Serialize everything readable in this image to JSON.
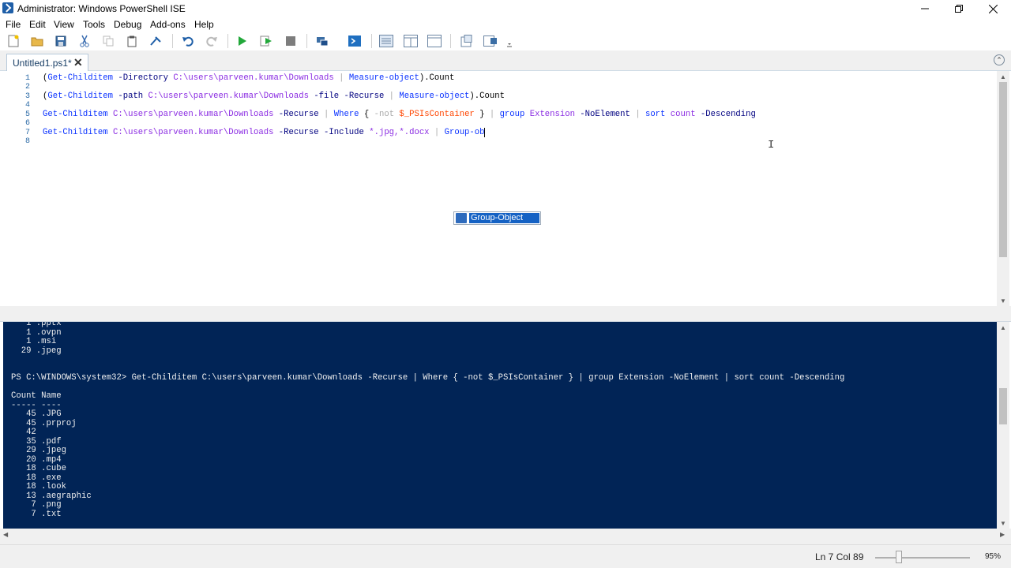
{
  "window": {
    "title": "Administrator: Windows PowerShell ISE",
    "controls": [
      "minimize",
      "restore",
      "close"
    ]
  },
  "menu": {
    "items": [
      "File",
      "Edit",
      "View",
      "Tools",
      "Debug",
      "Add-ons",
      "Help"
    ]
  },
  "toolbar": {
    "icons": [
      "new-file-icon",
      "open-folder-icon",
      "save-icon",
      "cut-icon",
      "copy-icon",
      "paste-icon",
      "clear-icon",
      "undo-icon",
      "redo-icon",
      "run-icon",
      "run-selection-icon",
      "stop-icon",
      "remote-powershell-icon",
      "powershell-console-icon",
      "show-script-pane-top-icon",
      "show-script-pane-right-icon",
      "show-script-pane-max-icon",
      "show-commands-icon",
      "show-command-addon-icon"
    ]
  },
  "tabs": [
    {
      "label": "Untitled1.ps1*",
      "close": "✕"
    }
  ],
  "editor": {
    "line_numbers": [
      "1",
      "2",
      "3",
      "4",
      "5",
      "6",
      "7",
      "8"
    ],
    "lines": [
      {
        "tokens": [
          {
            "t": "(",
            "c": "grp"
          },
          {
            "t": "Get-Childitem",
            "c": "cmd"
          },
          {
            "t": " -Directory ",
            "c": "par"
          },
          {
            "t": "C:\\users\\parveen.kumar\\Downloads",
            "c": "arg"
          },
          {
            "t": " | ",
            "c": "op"
          },
          {
            "t": "Measure-object",
            "c": "cmd"
          },
          {
            "t": ").Count",
            "c": "grp"
          }
        ]
      },
      {
        "tokens": []
      },
      {
        "tokens": [
          {
            "t": "(",
            "c": "grp"
          },
          {
            "t": "Get-Childitem",
            "c": "cmd"
          },
          {
            "t": " -path ",
            "c": "par"
          },
          {
            "t": "C:\\users\\parveen.kumar\\Downloads",
            "c": "arg"
          },
          {
            "t": " -file -Recurse",
            "c": "par"
          },
          {
            "t": " | ",
            "c": "op"
          },
          {
            "t": "Measure-object",
            "c": "cmd"
          },
          {
            "t": ").Count",
            "c": "grp"
          }
        ]
      },
      {
        "tokens": []
      },
      {
        "tokens": [
          {
            "t": "Get-Childitem",
            "c": "cmd"
          },
          {
            "t": " C:\\users\\parveen.kumar\\Downloads",
            "c": "arg"
          },
          {
            "t": " -Recurse",
            "c": "par"
          },
          {
            "t": " | ",
            "c": "op"
          },
          {
            "t": "Where",
            "c": "cmd"
          },
          {
            "t": " { ",
            "c": "grp"
          },
          {
            "t": "-not",
            "c": "op"
          },
          {
            "t": " $_PSIsContainer",
            "c": "var"
          },
          {
            "t": " } ",
            "c": "grp"
          },
          {
            "t": "| ",
            "c": "op"
          },
          {
            "t": "group",
            "c": "cmd"
          },
          {
            "t": " Extension",
            "c": "arg"
          },
          {
            "t": " -NoElement",
            "c": "par"
          },
          {
            "t": " | ",
            "c": "op"
          },
          {
            "t": "sort",
            "c": "cmd"
          },
          {
            "t": " count",
            "c": "arg"
          },
          {
            "t": " -Descending",
            "c": "par"
          }
        ]
      },
      {
        "tokens": []
      },
      {
        "tokens": [
          {
            "t": "Get-Childitem",
            "c": "cmd"
          },
          {
            "t": " C:\\users\\parveen.kumar\\Downloads",
            "c": "arg"
          },
          {
            "t": " -Recurse -Include ",
            "c": "par"
          },
          {
            "t": "*.jpg,*.docx",
            "c": "arg"
          },
          {
            "t": " | ",
            "c": "op"
          },
          {
            "t": "Group-ob",
            "c": "cmd"
          }
        ]
      },
      {
        "tokens": []
      }
    ],
    "intellisense": {
      "selected": "Group-Object"
    }
  },
  "console": {
    "lines": [
      "   1 .pptx",
      "   1 .ovpn",
      "   1 .msi",
      "  29 .jpeg",
      "",
      "",
      "PS C:\\WINDOWS\\system32> Get-Childitem C:\\users\\parveen.kumar\\Downloads -Recurse | Where { -not $_PSIsContainer } | group Extension -NoElement | sort count -Descending",
      "",
      "Count Name",
      "----- ----",
      "   45 .JPG",
      "   45 .prproj",
      "   42",
      "   35 .pdf",
      "   29 .jpeg",
      "   20 .mp4",
      "   18 .cube",
      "   18 .exe",
      "   18 .look",
      "   13 .aegraphic",
      "    7 .png",
      "    7 .txt"
    ]
  },
  "status": {
    "position": "Ln 7  Col 89",
    "zoom": "95%",
    "zoom_level": 0.25
  },
  "colors": {
    "console_bg": "#012456",
    "cmd": "#0a32ff",
    "selection": "#1562c4"
  }
}
